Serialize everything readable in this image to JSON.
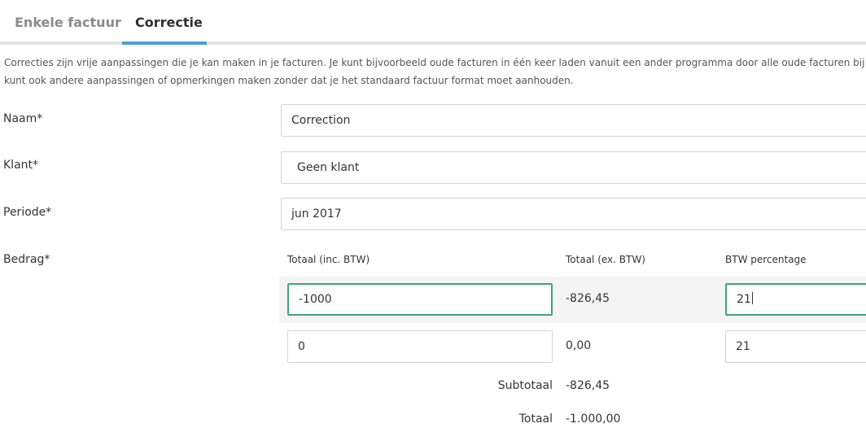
{
  "tabs": [
    {
      "label": "Enkele factuur"
    },
    {
      "label": "Correctie"
    }
  ],
  "description": {
    "line1": "Correcties zijn vrije aanpassingen die je kan maken in je facturen. Je kunt bijvoorbeeld oude facturen in één keer laden vanuit een ander programma door alle oude facturen bij",
    "line2": "kunt ook andere aanpassingen of opmerkingen maken zonder dat je het standaard factuur format moet aanhouden."
  },
  "form": {
    "naam_label": "Naam*",
    "naam_value": "Correction",
    "klant_label": "Klant*",
    "klant_value": "Geen klant",
    "periode_label": "Periode*",
    "periode_value": "jun 2017",
    "bedrag_label": "Bedrag*"
  },
  "amounts": {
    "headers": {
      "incl": "Totaal (inc. BTW)",
      "excl": "Totaal (ex. BTW)",
      "btw": "BTW percentage"
    },
    "rows": [
      {
        "incl": "-1000",
        "excl": "-826,45",
        "btw": "21"
      },
      {
        "incl": "0",
        "excl": "0,00",
        "btw": "21"
      }
    ],
    "subtotal_label": "Subtotaal",
    "subtotal_value": "-826,45",
    "total_label": "Totaal",
    "total_value": "-1.000,00"
  },
  "colors": {
    "tab_active_underline": "#4a9fd0",
    "focus_border": "#3aa77a"
  }
}
